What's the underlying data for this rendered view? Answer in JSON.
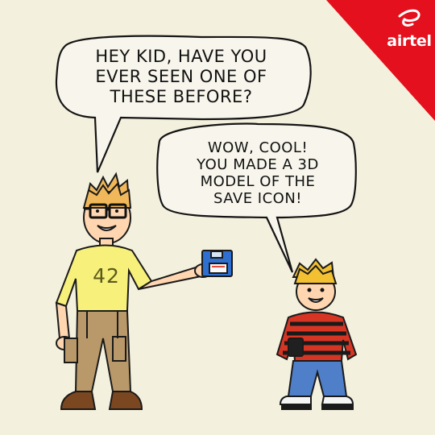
{
  "comic": {
    "speech_adult": "HEY KID, HAVE YOU\nEVER SEEN ONE OF\nTHESE BEFORE?",
    "speech_kid": "WOW, COOL!\nYOU MADE A 3D\nMODEL OF THE\nSAVE ICON!",
    "shirt_number": "42"
  },
  "brand": {
    "name": "airtel",
    "color": "#e4101d"
  },
  "colors": {
    "background": "#f4f0de",
    "adult_hair": "#f0b85a",
    "adult_shirt": "#f7f07a",
    "adult_pants": "#b9986a",
    "kid_hair": "#f2c030",
    "kid_sweater_red": "#d73524",
    "kid_sweater_black": "#1a1a1a",
    "kid_pants": "#4f7fc9",
    "floppy_disk": "#2f6fd0"
  }
}
